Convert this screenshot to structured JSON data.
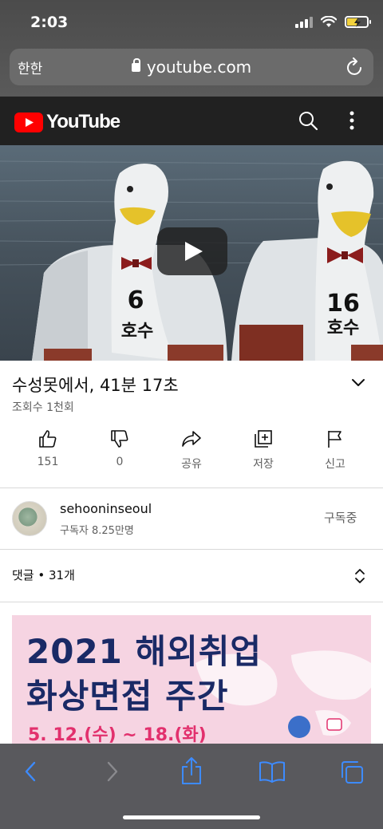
{
  "status_bar": {
    "time": "2:03"
  },
  "browser": {
    "aa_label": "한한",
    "url": "youtube.com"
  },
  "youtube": {
    "logo_text": "YouTube"
  },
  "video": {
    "title": "수성못에서, 41분 17초",
    "views": "조회수 1천회",
    "actions": [
      {
        "label": "151",
        "icon": "thumbs-up-icon"
      },
      {
        "label": "0",
        "icon": "thumbs-down-icon"
      },
      {
        "label": "공유",
        "icon": "share-icon"
      },
      {
        "label": "저장",
        "icon": "save-icon"
      },
      {
        "label": "신고",
        "icon": "flag-icon"
      }
    ]
  },
  "channel": {
    "name": "sehooninseoul",
    "subscribers": "구독자 8.25만명",
    "subscribe_status": "구독중"
  },
  "comments": {
    "label": "댓글 • 31개"
  },
  "ad": {
    "line1": "2021 해외취업",
    "line2": "화상면접 주간",
    "line3": "5. 12.(수) ~ 18.(화)"
  },
  "boat_left": {
    "number": "6",
    "label": "호수"
  },
  "boat_right": {
    "number": "16",
    "label": "호수"
  },
  "colors": {
    "accent_red": "#ff0000",
    "header_bg": "#212121",
    "ad_navy": "#1a2a66",
    "ad_pink": "#e2306d"
  }
}
